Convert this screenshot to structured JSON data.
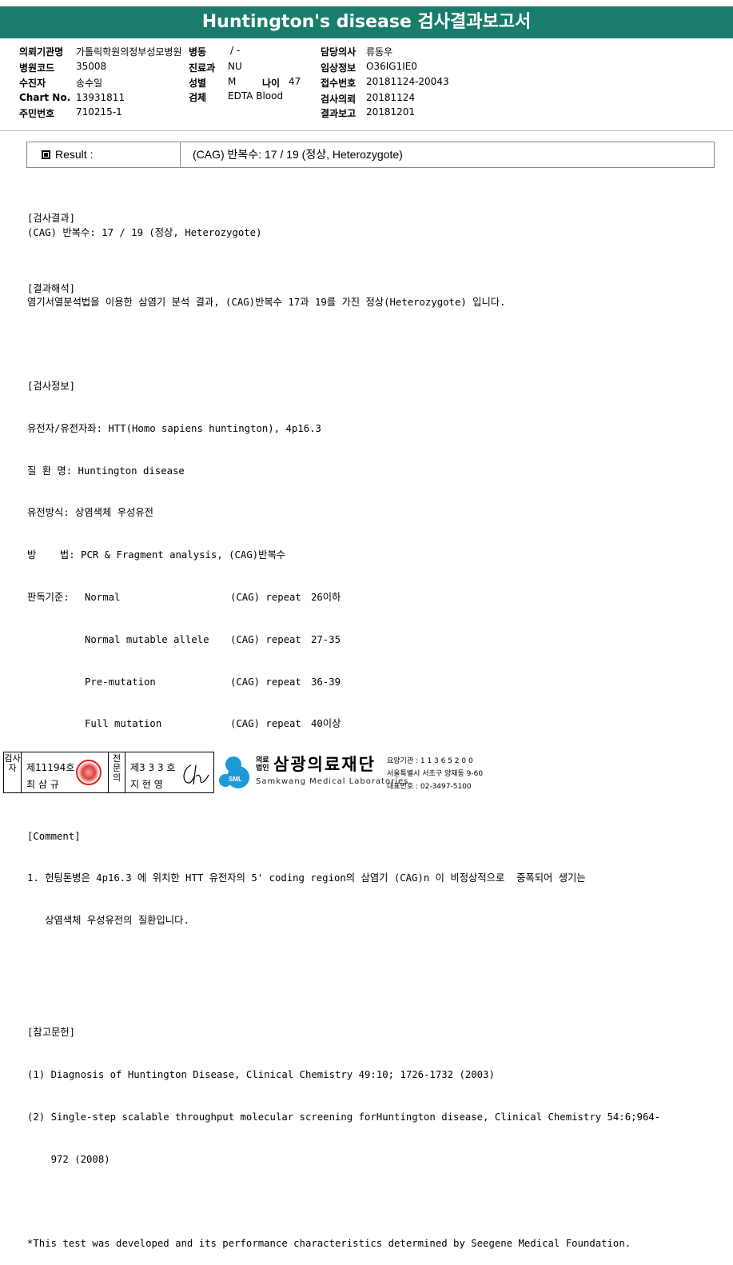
{
  "title": "Huntington's disease 검사결과보고서",
  "header": {
    "col1": [
      {
        "k": "의뢰기관명",
        "v": "가톨릭학원의정부성모병원"
      },
      {
        "k": "병원코드",
        "v": "35008"
      },
      {
        "k": "수진자",
        "v": "송수일"
      },
      {
        "k": "Chart No.",
        "v": "13931811"
      },
      {
        "k": "주민번호",
        "v": "710215-1"
      }
    ],
    "col2": [
      {
        "k": "병동",
        "v": "/ -"
      },
      {
        "k": "진료과",
        "v": "NU"
      },
      {
        "k": "성별",
        "v": "M"
      },
      {
        "k": "검체",
        "v": "EDTA Blood"
      }
    ],
    "age": {
      "k": "나이",
      "v": "47"
    },
    "col3": [
      {
        "k": "담당의사",
        "v": "류동우"
      },
      {
        "k": "임상정보",
        "v": "O36IG1IE0"
      },
      {
        "k": "접수번호",
        "v": "20181124-20043"
      },
      {
        "k": "검사의뢰",
        "v": "20181124"
      },
      {
        "k": "결과보고",
        "v": "20181201"
      }
    ]
  },
  "result": {
    "label": "Result :",
    "value": "(CAG) 반복수: 17 / 19 (정상, Heterozygote)"
  },
  "sections": {
    "result_head": "[검사결과]",
    "result_text": "(CAG) 반복수: 17 / 19 (정상, Heterozygote)",
    "interp_head": "[결과해석]",
    "interp_text": "염기서열분석법을 이용한 삼염기 분석 결과, (CAG)반복수 17과 19를 가진 정상(Heterozygote) 입니다.",
    "info_head": "[검사정보]",
    "info_gene": "유전자/유전자좌: HTT(Homo sapiens huntington), 4p16.3",
    "info_disease": "질 환 명: Huntington disease",
    "info_inherit": "유전방식: 상염색체 우성유전",
    "info_method": "방    법: PCR & Fragment analysis, (CAG)반복수",
    "criteria_label": "판독기준:",
    "criteria": [
      {
        "name": "Normal",
        "repeat": "(CAG) repeat",
        "range": "26이하"
      },
      {
        "name": "Normal mutable allele",
        "repeat": "(CAG) repeat",
        "range": "27-35"
      },
      {
        "name": "Pre-mutation",
        "repeat": "(CAG) repeat",
        "range": "36-39"
      },
      {
        "name": "Full mutation",
        "repeat": "(CAG) repeat",
        "range": "40이상"
      }
    ],
    "comment_head": "[Comment]",
    "comment_1": "1. 헌팅톤병은 4p16.3 에 위치한 HTT 유전자의 5' coding region의 삼염기 (CAG)n 이 비정상적으로  중폭되어 생기는",
    "comment_2": "   상염색체 우성유전의 질환입니다.",
    "ref_head": "[참고문헌]",
    "ref_1": "(1) Diagnosis of Huntington Disease, Clinical Chemistry 49:10; 1726-1732 (2003)",
    "ref_2a": "(2) Single-step scalable throughput molecular screening forHuntington disease, Clinical Chemistry 54:6;964-",
    "ref_2b": "    972 (2008)",
    "note": "*This test was developed and its performance characteristics determined by Seegene Medical Foundation."
  },
  "footer": {
    "tester_label": "검사자",
    "tester_no": "제11194호",
    "tester_name": "최 삼 규",
    "specialist_label": "전문의",
    "specialist_no": "제3 3 3 호",
    "specialist_name": "지 현 영",
    "logo_text": "SML",
    "org_sub": "의료법인",
    "org_name": "삼광의료재단",
    "org_eng": "Samkwang Medical Laboratories",
    "code": "요양기관 : 1 1 3 6 5 2 0 0",
    "address": "서울특별시 서초구 양재동 9-60",
    "phone": "대표번호 : 02-3497-5100"
  }
}
